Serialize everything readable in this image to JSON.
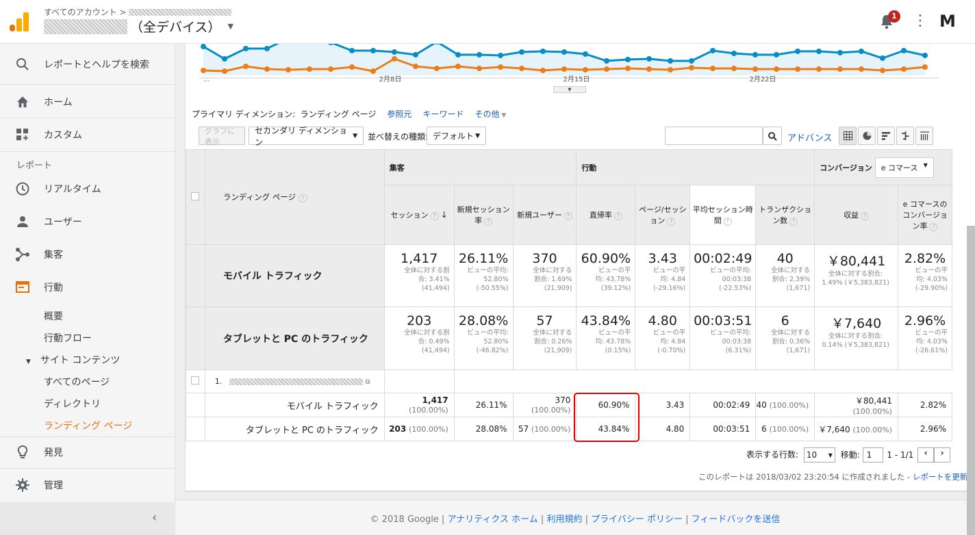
{
  "header": {
    "account_crumb": "すべてのアカウント",
    "property": "（全デバイス）",
    "notifications": "1",
    "avatar": "M"
  },
  "sidebar": {
    "search": "レポートとヘルプを検索",
    "home": "ホーム",
    "custom": "カスタム",
    "reports_heading": "レポート",
    "realtime": "リアルタイム",
    "users": "ユーザー",
    "acquisition": "集客",
    "behavior": "行動",
    "behavior_sub": {
      "overview": "概要",
      "flow": "行動フロー",
      "site_content": "サイト コンテンツ",
      "all_pages": "すべてのページ",
      "directory": "ディレクトリ",
      "landing": "ランディング ページ"
    },
    "discover": "発見",
    "admin": "管理"
  },
  "chart": {
    "x_labels": [
      "...",
      "2月8日",
      "2月15日",
      "2月22日"
    ],
    "series": [
      {
        "color": "#058dc7",
        "values": [
          68,
          86,
          71,
          71,
          56,
          60,
          62,
          74,
          74,
          76,
          80,
          61,
          80,
          80,
          81,
          76,
          75,
          76,
          79,
          89,
          87,
          86,
          89,
          89,
          74,
          78,
          80,
          80,
          75,
          75,
          77,
          75,
          85,
          74,
          81
        ]
      },
      {
        "color": "#ed7e17",
        "values": [
          103,
          104,
          97,
          101,
          102,
          101,
          101,
          98,
          104,
          86,
          97,
          100,
          97,
          100,
          98,
          100,
          103,
          101,
          102,
          101,
          100,
          101,
          102,
          99,
          100,
          100,
          101,
          101,
          101,
          101,
          101,
          101,
          103,
          101,
          98
        ]
      }
    ]
  },
  "dimension": {
    "label": "プライマリ ディメンション:",
    "current": "ランディング ページ",
    "alt1": "参照元",
    "alt2": "キーワード",
    "other": "その他"
  },
  "toolbar": {
    "graph_btn": "グラフに表示",
    "secondary": "セカンダリ ディメンション",
    "sort_label": "並べ替えの種類:",
    "sort_value": "デフォルト",
    "advanced": "アドバンス"
  },
  "table": {
    "col_landing": "ランディング ページ",
    "group_acq": "集客",
    "group_beh": "行動",
    "group_conv": "コンバージョン",
    "conv_select": "e コマース",
    "cols": [
      "セッション",
      "新規セッション率",
      "新規ユーザー",
      "直帰率",
      "ページ/セッション",
      "平均セッション時間",
      "トランザクション数",
      "収益",
      "e コマースのコンバージョン率"
    ],
    "segments": [
      {
        "name": "モバイル トラフィック",
        "values": [
          "1,417",
          "26.11%",
          "370",
          "60.90%",
          "3.43",
          "00:02:49",
          "40",
          "￥80,441",
          "2.82%"
        ],
        "subs": [
          [
            "全体に対する割",
            "合: 3.41%",
            "(41,494)"
          ],
          [
            "ビューの平均:",
            "52.80%",
            "(-50.55%)"
          ],
          [
            "全体に対する",
            "割合: 1.69%",
            "(21,909)"
          ],
          [
            "ビューの平",
            "均: 43.78%",
            "(39.12%)"
          ],
          [
            "ビューの平",
            "均: 4.84",
            "(-29.16%)"
          ],
          [
            "ビューの平均:",
            "00:03:38",
            "(-22.53%)"
          ],
          [
            "全体に対する",
            "割合: 2.39%",
            "(1,671)"
          ],
          [
            "全体に対する割合:",
            "1.49% (￥5,383,821)",
            ""
          ],
          [
            "ビューの平",
            "均: 4.03%",
            "(-29.90%)"
          ]
        ]
      },
      {
        "name": "タブレットと PC のトラフィック",
        "values": [
          "203",
          "28.08%",
          "57",
          "43.84%",
          "4.80",
          "00:03:51",
          "6",
          "￥7,640",
          "2.96%"
        ],
        "subs": [
          [
            "全体に対する割",
            "合: 0.49%",
            "(41,494)"
          ],
          [
            "ビューの平均:",
            "52.80%",
            "(-46.82%)"
          ],
          [
            "全体に対する",
            "割合: 0.26%",
            "(21,909)"
          ],
          [
            "ビューの平",
            "均: 43.78%",
            "(0.15%)"
          ],
          [
            "ビューの平",
            "均: 4.84",
            "(-0.70%)"
          ],
          [
            "ビューの平均:",
            "00:03:38",
            "(6.31%)"
          ],
          [
            "全体に対する",
            "割合: 0.36%",
            "(1,671)"
          ],
          [
            "全体に対する割合:",
            "0.14% (￥5,383,821)",
            ""
          ],
          [
            "ビューの平",
            "均: 4.03%",
            "(-26.61%)"
          ]
        ]
      }
    ],
    "row_index": "1.",
    "rows": [
      {
        "name": "モバイル トラフィック",
        "sessions": "1,417",
        "sessions_pct": "(100.00%)",
        "new_rate": "26.11%",
        "new_users": "370",
        "new_users_pct": "(100.00%)",
        "bounce": "60.90%",
        "pps": "3.43",
        "avg": "00:02:49",
        "tx": "40",
        "tx_pct": "(100.00%)",
        "rev": "￥80,441",
        "rev_pct": "(100.00%)",
        "cr": "2.82%"
      },
      {
        "name": "タブレットと PC のトラフィック",
        "sessions": "203",
        "sessions_pct": "(100.00%)",
        "new_rate": "28.08%",
        "new_users": "57",
        "new_users_pct": "(100.00%)",
        "bounce": "43.84%",
        "pps": "4.80",
        "avg": "00:03:51",
        "tx": "6",
        "tx_pct": "(100.00%)",
        "rev": "￥7,640",
        "rev_pct": "(100.00%)",
        "cr": "2.96%"
      }
    ]
  },
  "pager": {
    "rows_label": "表示する行数:",
    "rows_value": "10",
    "goto_label": "移動:",
    "goto_value": "1",
    "range": "1 - 1/1"
  },
  "generated": {
    "text": "このレポートは 2018/03/02 23:20:54 に作成されました -",
    "link": "レポートを更新"
  },
  "footer": {
    "copy": "© 2018 Google |",
    "home": "アナリティクス ホーム",
    "terms": "利用規約",
    "privacy": "プライバシー ポリシー",
    "feedback": "フィードバックを送信"
  }
}
